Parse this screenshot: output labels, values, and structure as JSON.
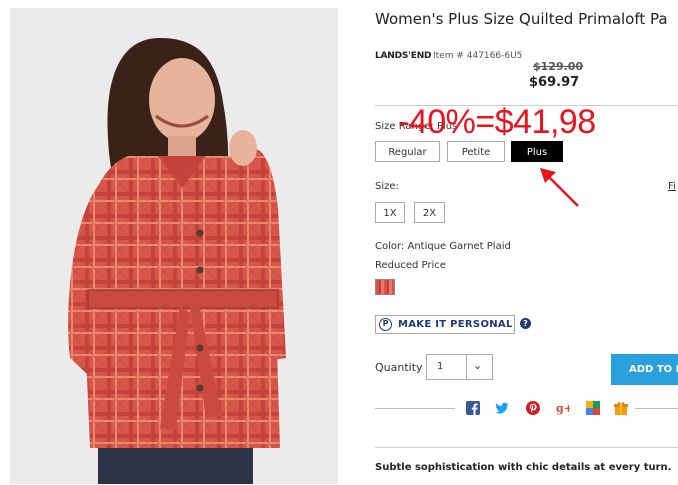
{
  "product": {
    "title": "Women's Plus Size Quilted Primaloft Pa",
    "brand": "LANDS'END",
    "item_number": "Item # 447166-6U5",
    "original_price": "$129.00",
    "sale_price": "$69.97"
  },
  "annotation": {
    "discount_text": "-40%=$41,98",
    "color": "#e8131c"
  },
  "size_range": {
    "label": "Size Range: Plus",
    "options": [
      "Regular",
      "Petite",
      "Plus"
    ],
    "selected": "Plus"
  },
  "size": {
    "label": "Size:",
    "options": [
      "1X",
      "2X"
    ],
    "fit_link": "Fi"
  },
  "color": {
    "label": "Color: Antique Garnet Plaid",
    "status": "Reduced Price"
  },
  "personalize": {
    "icon_letter": "P",
    "label": "MAKE IT PERSONAL",
    "help": "?"
  },
  "quantity": {
    "label": "Quantity",
    "value": "1"
  },
  "cart": {
    "add_label": "ADD TO BAG"
  },
  "social_icons": [
    "facebook-icon",
    "twitter-icon",
    "pinterest-icon",
    "google-plus-icon",
    "bookmark-icon",
    "gift-icon"
  ],
  "tagline": "Subtle sophistication with chic details at every turn.",
  "colors": {
    "accent_blue": "#2aa0dc",
    "brand_navy": "#1f3a7a",
    "annotation_red": "#e8131c"
  }
}
